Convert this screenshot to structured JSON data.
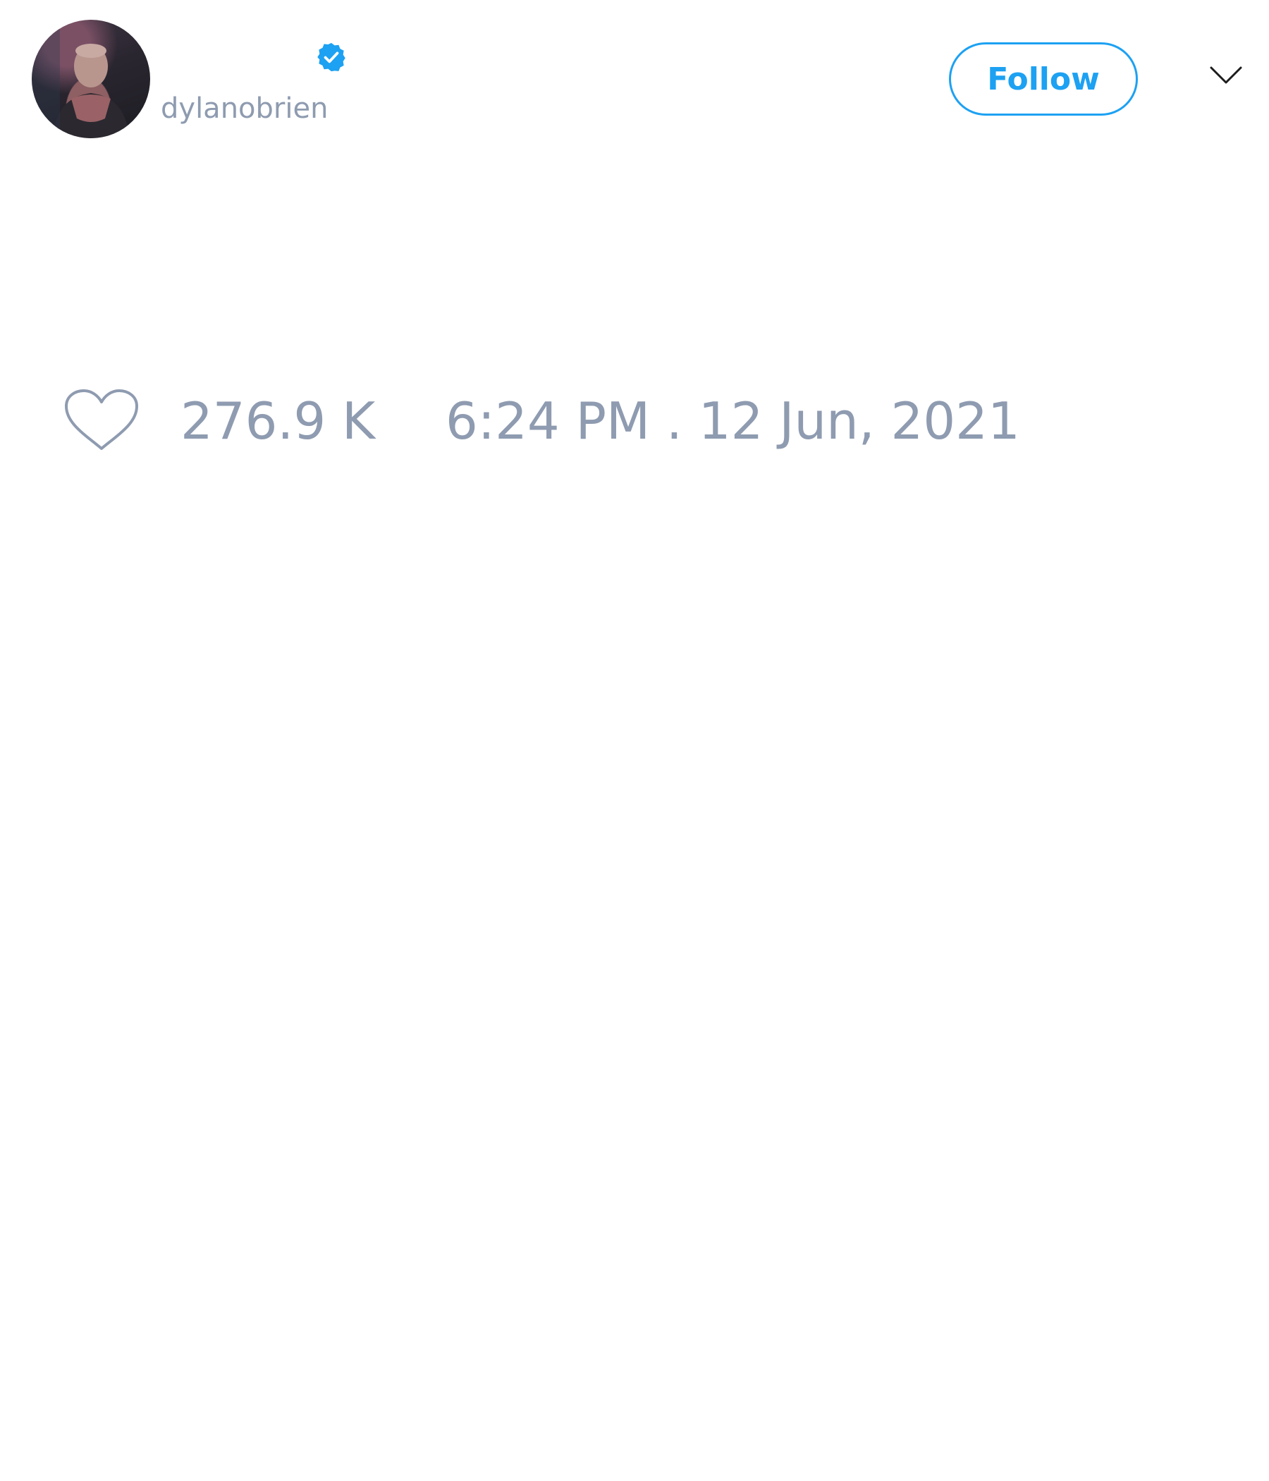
{
  "tweet": {
    "author": {
      "avatar_alt": "profile photo",
      "verified_icon": "verified-badge-icon",
      "handle": "dylanobrien"
    },
    "follow_label": "Follow",
    "menu_icon": "chevron-down-icon",
    "like_icon": "heart-outline-icon",
    "like_count": "276.9 K",
    "timestamp": "6:24 PM . 12 Jun, 2021"
  },
  "colors": {
    "accent": "#1da1f2",
    "muted_text": "#8e9bb0",
    "background": "#ffffff"
  }
}
